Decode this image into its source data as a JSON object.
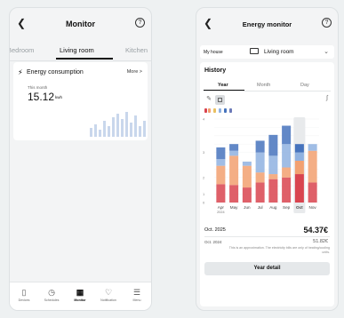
{
  "left": {
    "title": "Monitor",
    "rooms": [
      "Bedroom",
      "Living room",
      "Kitchen"
    ],
    "card": {
      "title": "Energy consumption",
      "more": "More >",
      "period": "This month",
      "value": "15.12",
      "unit": "kwh"
    },
    "tabs": [
      {
        "label": "Devices",
        "icon": "device-icon"
      },
      {
        "label": "Schedules",
        "icon": "schedule-icon"
      },
      {
        "label": "Monitor",
        "icon": "monitor-icon"
      },
      {
        "label": "Notification",
        "icon": "bell-icon"
      },
      {
        "label": "Menu",
        "icon": "menu-icon"
      }
    ]
  },
  "right": {
    "title": "Energy monitor",
    "house": "My house",
    "room": "Living room",
    "history_title": "History",
    "periods": [
      "Year",
      "Month",
      "Day"
    ],
    "selected_label": "Oct. 2025",
    "selected_value": "54.37€",
    "compare_label": "Oct. 2024",
    "compare_value": "51.82€",
    "note": "This is an approximation. The electricity bills are only of heating/cooling units.",
    "button": "Year detail"
  },
  "chart_data": {
    "type": "bar",
    "categories": [
      "Apr",
      "May",
      "Jun",
      "Jul",
      "Aug",
      "Sep",
      "Oct",
      "Nov"
    ],
    "category_sublabels": [
      "2024",
      "",
      "",
      "",
      "",
      "",
      "",
      ""
    ],
    "y_ticks": [
      "4",
      "",
      "",
      "",
      "3",
      "",
      "",
      "2",
      "",
      "1",
      "0"
    ],
    "ylim": [
      0,
      100
    ],
    "stacked": true,
    "selected_category": "Oct",
    "series": [
      {
        "values": [
          22,
          21,
          18,
          24,
          28,
          30,
          34,
          24
        ],
        "color": "#d9444f"
      },
      {
        "values": [
          22,
          35,
          26,
          12,
          6,
          12,
          16,
          38
        ],
        "color": "#f2a070"
      },
      {
        "values": [
          8,
          6,
          5,
          24,
          22,
          28,
          10,
          8
        ],
        "color": "#8fb1e0"
      },
      {
        "values": [
          14,
          8,
          0,
          14,
          25,
          22,
          10,
          0
        ],
        "color": "#4673bd"
      }
    ]
  }
}
